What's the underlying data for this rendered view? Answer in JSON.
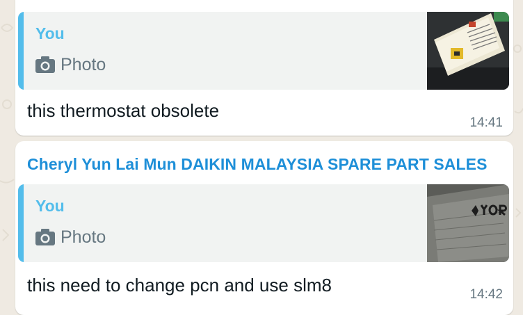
{
  "messages": [
    {
      "quote": {
        "author": "You",
        "type_icon": "camera-icon",
        "type_label": "Photo",
        "thumbnail": "thermostat photo"
      },
      "text": "this thermostat obsolete",
      "time": "14:41"
    },
    {
      "sender": "Cheryl Yun Lai Mun DAIKIN MALAYSIA SPARE PART SALES",
      "quote": {
        "author": "You",
        "type_icon": "camera-icon",
        "type_label": "Photo",
        "thumbnail": "YORK nameplate photo"
      },
      "text": "this need to change pcn and use slm8",
      "time": "14:42"
    }
  ],
  "colors": {
    "chat_background": "#efeae2",
    "sender_name": "#1e8fd8",
    "quote_accent": "#53bdeb",
    "meta_text": "#667781"
  }
}
